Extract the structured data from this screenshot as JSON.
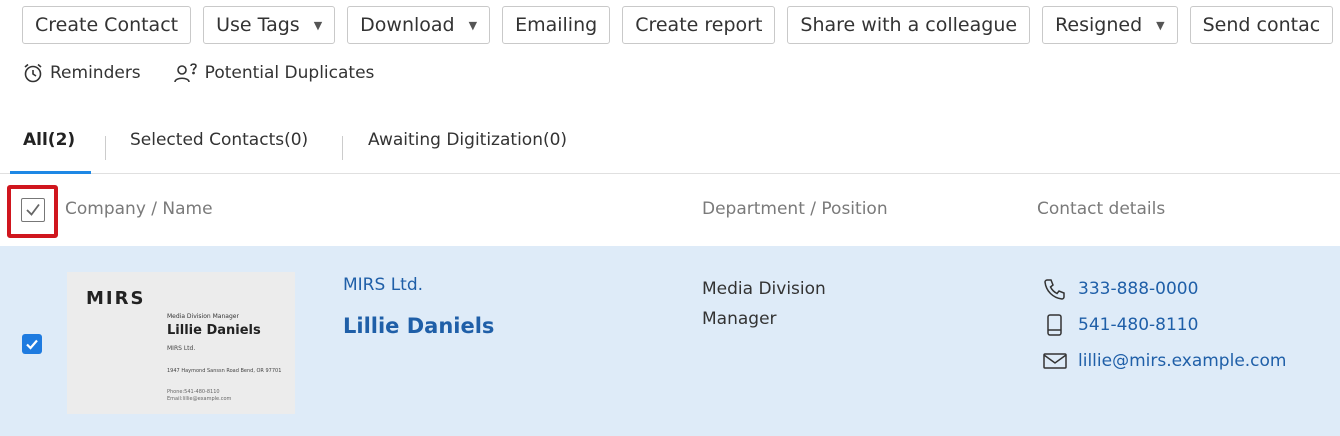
{
  "toolbar": {
    "create_contact": "Create Contact",
    "use_tags": "Use Tags",
    "download": "Download",
    "emailing": "Emailing",
    "create_report": "Create report",
    "share": "Share with a colleague",
    "resigned": "Resigned",
    "send_contact": "Send contac",
    "caret": "▼"
  },
  "subbar": {
    "reminders": "Reminders",
    "duplicates": "Potential Duplicates"
  },
  "tabs": [
    {
      "label": "All(2)"
    },
    {
      "label": "Selected Contacts(0)"
    },
    {
      "label": "Awaiting Digitization(0)"
    }
  ],
  "table": {
    "headers": {
      "company_name": "Company / Name",
      "dept_position": "Department / Position",
      "contact_details": "Contact details"
    },
    "rows": [
      {
        "checked": true,
        "company": "MIRS Ltd.",
        "name": "Lillie Daniels",
        "department": "Media Division",
        "position": "Manager",
        "phone": "333-888-0000",
        "mobile": "541-480-8110",
        "email": "lillie@mirs.example.com",
        "card": {
          "logo": "MIRS",
          "position": "Media Division Manager",
          "name": "Lillie Daniels",
          "company": "MIRS Ltd.",
          "address": "1947 Haymond Sanssn Road Bend, OR 97701",
          "phone": "Phone:541-480-8110",
          "email": "Email:lillie@example.com"
        }
      }
    ]
  },
  "colors": {
    "accent": "#1e88e5",
    "link": "#1f5fa8",
    "row_selected": "#deebf8",
    "highlight": "#d0161e"
  }
}
